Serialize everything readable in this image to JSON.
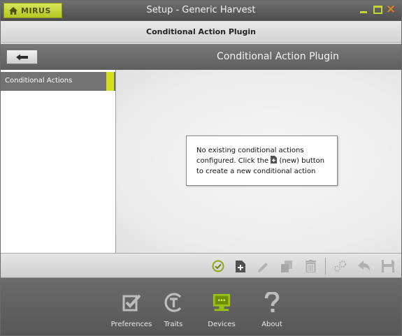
{
  "window": {
    "brand": "MIRUS",
    "title": "Setup - Generic Harvest",
    "subtitle": "Conditional Action Plugin"
  },
  "header": {
    "title": "Conditional Action Plugin"
  },
  "sidebar": {
    "items": [
      {
        "label": "Conditional Actions",
        "selected": true
      }
    ]
  },
  "message": {
    "line1": "No existing conditional actions",
    "line2_pre": "configured.  Click the",
    "line2_post": "(new) button",
    "line3": "to create a new conditional action"
  },
  "toolbar": {
    "buttons": [
      "check-icon",
      "new-icon",
      "edit-icon",
      "copy-icon",
      "delete-icon",
      "settings-icon",
      "undo-icon",
      "save-icon"
    ]
  },
  "nav": {
    "items": [
      {
        "label": "Preferences",
        "icon": "checkbox-icon"
      },
      {
        "label": "Traits",
        "icon": "traits-icon"
      },
      {
        "label": "Devices",
        "icon": "device-icon"
      },
      {
        "label": "About",
        "icon": "question-icon"
      }
    ]
  },
  "colors": {
    "accent": "#c6d630",
    "close": "#f08a10",
    "check": "#8fa816",
    "device": "#9bc20e"
  }
}
